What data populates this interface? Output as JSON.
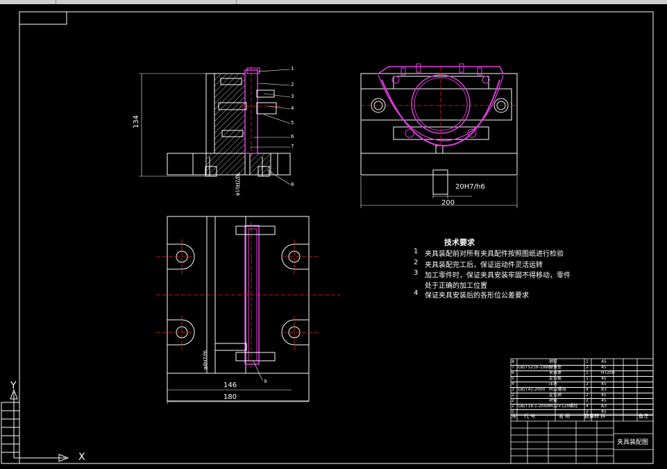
{
  "tech_requirements": {
    "title": "技术要求",
    "items": [
      {
        "num": "1",
        "text": "夹具装配前对所有夹具配件按照图纸进行检验"
      },
      {
        "num": "2",
        "text": "夹具装配完工后，保证运动件灵活运转"
      },
      {
        "num": "3",
        "text": "加工零件时，保证夹具安装牢固不得移动，零件"
      },
      {
        "num": "",
        "text": "处于正确的加工位置"
      },
      {
        "num": "4",
        "text": "保证夹具安装后的各形位公差要求"
      }
    ]
  },
  "dimensions": {
    "left_height": "134",
    "front_fit": "20H7/h6",
    "front_width": "200",
    "bottom_inner": "146",
    "bottom_outer": "180",
    "left_fit": "φ10H7/f6",
    "bottom_fit": "φ8H7/f6"
  },
  "axis": {
    "x": "X",
    "y": "Y"
  },
  "title_block": {
    "drawing_name": "夹具装配图",
    "header": [
      "序",
      "代  号",
      "名  称",
      "数量",
      "材  料",
      "",
      "备注"
    ],
    "rows": [
      {
        "no": "8",
        "code": "",
        "name": "销钉",
        "qty": "1",
        "mat": "45"
      },
      {
        "no": "7",
        "code": "GB/T5216-1986",
        "name": "弹簧垫",
        "qty": "2",
        "mat": "45"
      },
      {
        "no": "6",
        "code": "",
        "name": "夹具体",
        "qty": "1",
        "mat": "HT200"
      },
      {
        "no": "5",
        "code": "",
        "name": "定位板",
        "qty": "1",
        "mat": "45"
      },
      {
        "no": "4",
        "code": "",
        "name": "压块",
        "qty": "2",
        "mat": "45"
      },
      {
        "no": "3",
        "code": "GB/T41-2000",
        "name": "M12螺母",
        "qty": "4",
        "mat": "A3"
      },
      {
        "no": "2",
        "code": "",
        "name": "定位销",
        "qty": "2",
        "mat": "45"
      },
      {
        "no": "2",
        "code": "",
        "name": "衬套",
        "qty": "2",
        "mat": "45"
      },
      {
        "no": "2",
        "code": "GB/T18.1-2000",
        "name": "M12×120螺栓",
        "qty": "4",
        "mat": "A3"
      },
      {
        "no": "1",
        "code": "",
        "name": "",
        "qty": "2",
        "mat": "45"
      }
    ]
  },
  "balloons": [
    "1",
    "2",
    "3",
    "4",
    "5",
    "6",
    "7",
    "8",
    "9"
  ],
  "colors": {
    "background": "#000000",
    "line": "#ffffff",
    "part": "#e040e0",
    "center": "#ff2020"
  }
}
